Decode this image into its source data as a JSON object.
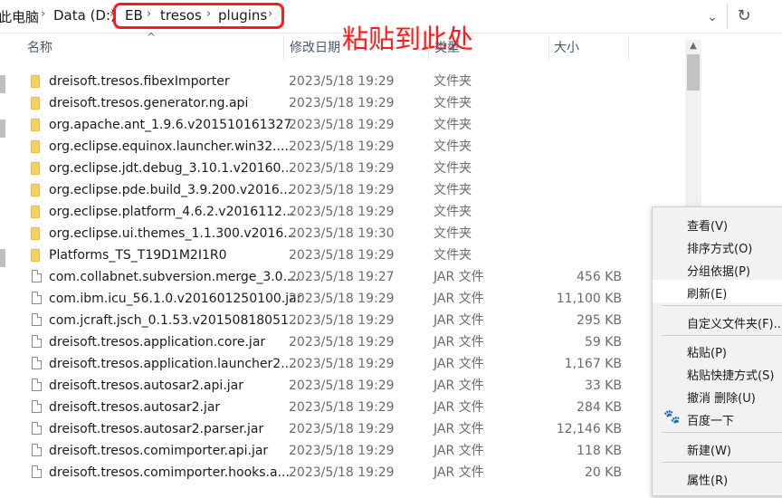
{
  "address_bar": {
    "breadcrumbs": [
      "此电脑",
      "Data (D:)",
      "EB",
      "tresos",
      "plugins"
    ],
    "dropdown_icon": "chevron-down-icon",
    "refresh_icon": "refresh-icon"
  },
  "annotation": {
    "text": "粘贴到此处",
    "color": "#ff1a1a"
  },
  "columns": {
    "name": "名称",
    "date": "修改日期",
    "type": "类型",
    "size": "大小"
  },
  "files": [
    {
      "name": "dreisoft.tresos.fibexImporter",
      "date": "2023/5/18 19:29",
      "type": "文件夹",
      "size": "",
      "kind": "folder"
    },
    {
      "name": "dreisoft.tresos.generator.ng.api",
      "date": "2023/5/18 19:29",
      "type": "文件夹",
      "size": "",
      "kind": "folder"
    },
    {
      "name": "org.apache.ant_1.9.6.v201510161327",
      "date": "2023/5/18 19:29",
      "type": "文件夹",
      "size": "",
      "kind": "folder"
    },
    {
      "name": "org.eclipse.equinox.launcher.win32....",
      "date": "2023/5/18 19:29",
      "type": "文件夹",
      "size": "",
      "kind": "folder"
    },
    {
      "name": "org.eclipse.jdt.debug_3.10.1.v20160...",
      "date": "2023/5/18 19:29",
      "type": "文件夹",
      "size": "",
      "kind": "folder"
    },
    {
      "name": "org.eclipse.pde.build_3.9.200.v2016...",
      "date": "2023/5/18 19:29",
      "type": "文件夹",
      "size": "",
      "kind": "folder"
    },
    {
      "name": "org.eclipse.platform_4.6.2.v2016112...",
      "date": "2023/5/18 19:29",
      "type": "文件夹",
      "size": "",
      "kind": "folder"
    },
    {
      "name": "org.eclipse.ui.themes_1.1.300.v2016...",
      "date": "2023/5/18 19:30",
      "type": "文件夹",
      "size": "",
      "kind": "folder"
    },
    {
      "name": "Platforms_TS_T19D1M2I1R0",
      "date": "2023/5/18 19:29",
      "type": "文件夹",
      "size": "",
      "kind": "folder"
    },
    {
      "name": "com.collabnet.subversion.merge_3.0....",
      "date": "2023/5/18 19:27",
      "type": "JAR 文件",
      "size": "456 KB",
      "kind": "file"
    },
    {
      "name": "com.ibm.icu_56.1.0.v201601250100.jar",
      "date": "2023/5/18 19:29",
      "type": "JAR 文件",
      "size": "11,100 KB",
      "kind": "file"
    },
    {
      "name": "com.jcraft.jsch_0.1.53.v20150818051...",
      "date": "2023/5/18 19:29",
      "type": "JAR 文件",
      "size": "295 KB",
      "kind": "file"
    },
    {
      "name": "dreisoft.tresos.application.core.jar",
      "date": "2023/5/18 19:29",
      "type": "JAR 文件",
      "size": "59 KB",
      "kind": "file"
    },
    {
      "name": "dreisoft.tresos.application.launcher2....",
      "date": "2023/5/18 19:29",
      "type": "JAR 文件",
      "size": "1,167 KB",
      "kind": "file"
    },
    {
      "name": "dreisoft.tresos.autosar2.api.jar",
      "date": "2023/5/18 19:29",
      "type": "JAR 文件",
      "size": "33 KB",
      "kind": "file"
    },
    {
      "name": "dreisoft.tresos.autosar2.jar",
      "date": "2023/5/18 19:29",
      "type": "JAR 文件",
      "size": "284 KB",
      "kind": "file"
    },
    {
      "name": "dreisoft.tresos.autosar2.parser.jar",
      "date": "2023/5/18 19:29",
      "type": "JAR 文件",
      "size": "12,146 KB",
      "kind": "file"
    },
    {
      "name": "dreisoft.tresos.comimporter.api.jar",
      "date": "2023/5/18 19:29",
      "type": "JAR 文件",
      "size": "118 KB",
      "kind": "file"
    },
    {
      "name": "dreisoft.tresos.comimporter.hooks.a...",
      "date": "2023/5/18 19:29",
      "type": "JAR 文件",
      "size": "20 KB",
      "kind": "file"
    }
  ],
  "context_menu": {
    "view": "查看(V)",
    "sort": "排序方式(O)",
    "group": "分组依据(P)",
    "refresh": "刷新(E)",
    "customize": "自定义文件夹(F)...",
    "paste": "粘贴(P)",
    "paste_shortcut": "粘贴快捷方式(S)",
    "undo_delete": "撤消 删除(U)",
    "baidu": "百度一下",
    "new": "新建(W)",
    "properties": "属性(R)"
  }
}
